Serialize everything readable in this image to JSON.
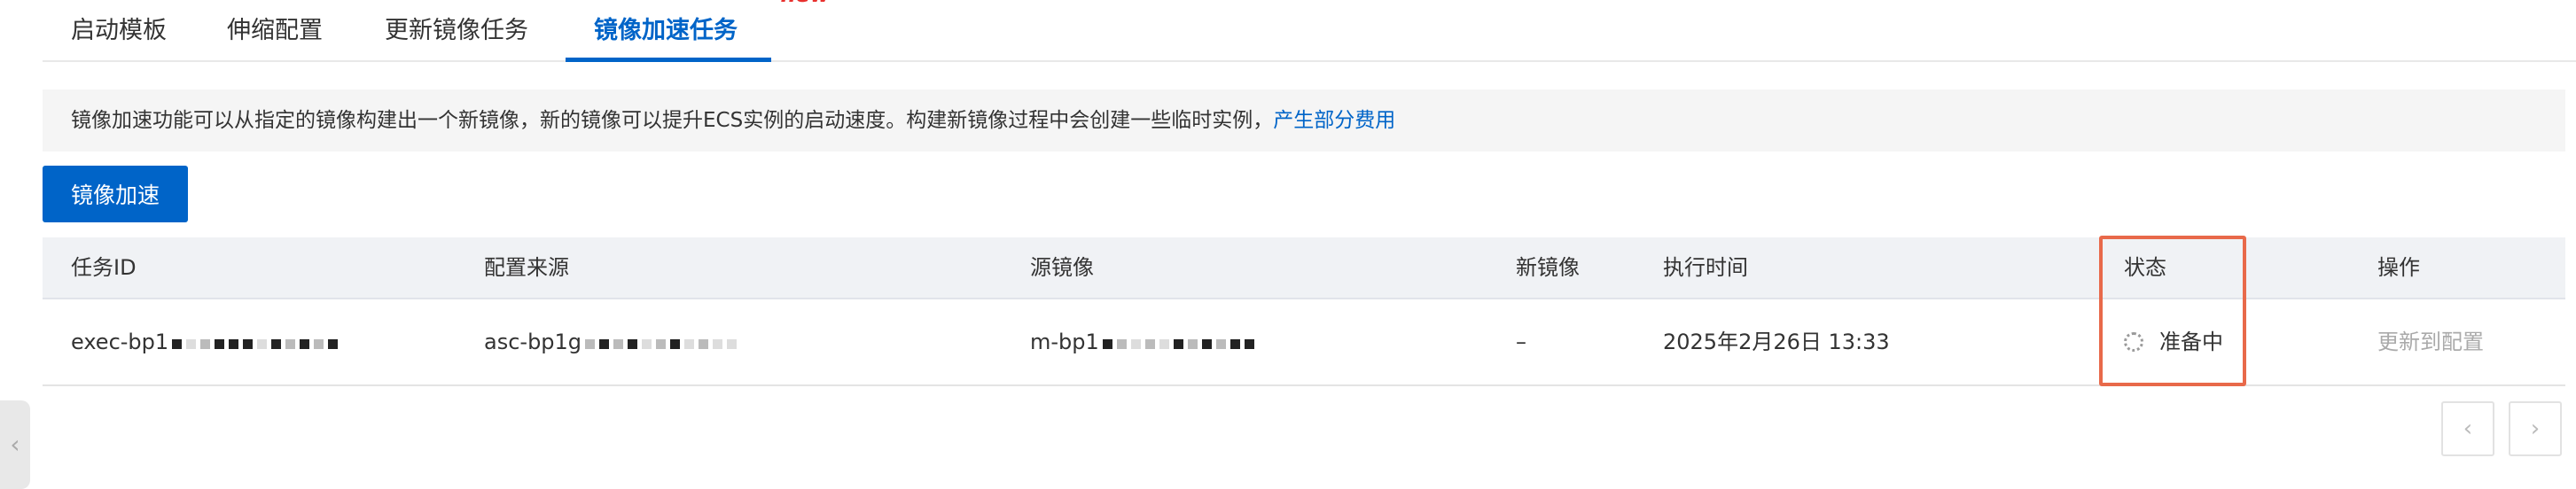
{
  "tabs": [
    {
      "label": "启动模板"
    },
    {
      "label": "伸缩配置"
    },
    {
      "label": "更新镜像任务"
    },
    {
      "label": "镜像加速任务",
      "badge": "new"
    }
  ],
  "notice": {
    "text": "镜像加速功能可以从指定的镜像构建出一个新镜像，新的镜像可以提升ECS实例的启动速度。构建新镜像过程中会创建一些临时实例，",
    "link": "产生部分费用"
  },
  "actions": {
    "accelerate_button": "镜像加速"
  },
  "table": {
    "headers": {
      "task_id": "任务ID",
      "config_source": "配置来源",
      "source_image": "源镜像",
      "new_image": "新镜像",
      "exec_time": "执行时间",
      "status": "状态",
      "operation": "操作"
    },
    "rows": [
      {
        "task_id": "exec-bp1",
        "config_source": "asc-bp1g",
        "source_image": "m-bp1",
        "new_image": "–",
        "exec_time": "2025年2月26日 13:33",
        "status": "准备中",
        "operation": "更新到配置"
      }
    ]
  },
  "pagination": {
    "prev": "‹",
    "next": "›"
  },
  "side_handle": {
    "glyph": "‹"
  },
  "colors": {
    "primary": "#0064c8",
    "badge": "#e8302e",
    "highlight": "#e8694a"
  }
}
